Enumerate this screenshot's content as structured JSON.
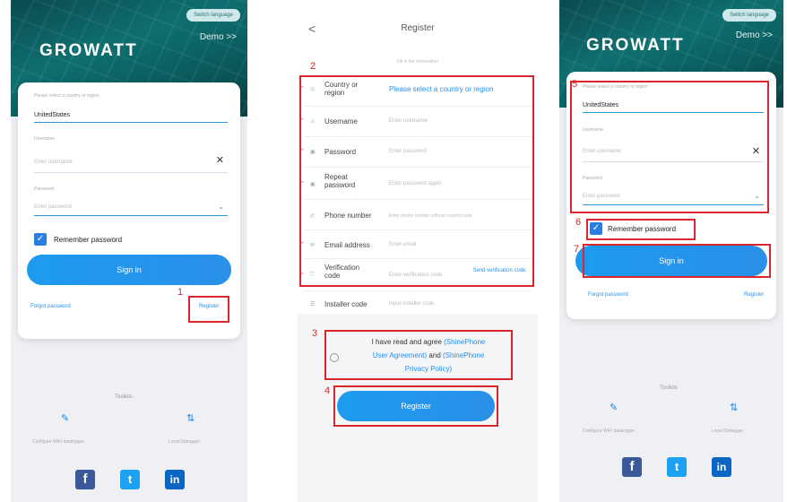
{
  "login1": {
    "lang_pill": "Switch language",
    "demo": "Demo >>",
    "logo": "GROWATT",
    "country_label": "Please select a country or region",
    "country_value": "UnitedStates",
    "user_label": "Username",
    "user_placeholder": "Enter username",
    "pwd_label": "Password",
    "pwd_placeholder": "Enter password",
    "remember": "Remember password",
    "signin": "Sign in",
    "forgot": "Forgot password",
    "register": "Register",
    "tools_title": "Toolkits",
    "tool1": "Configure WiFi datalogger",
    "tool2": "Local Debugger",
    "ann1": "1"
  },
  "register": {
    "back": "<",
    "title": "Register",
    "hint": "Fill in the information",
    "ann2": "2",
    "ann3": "3",
    "ann4": "4",
    "rows": [
      {
        "label": "Country or region",
        "placeholder": "Please select a country or region"
      },
      {
        "label": "Username",
        "placeholder": "Enter username"
      },
      {
        "label": "Password",
        "placeholder": "Enter password"
      },
      {
        "label": "Repeat password",
        "placeholder": "Enter password again"
      },
      {
        "label": "Phone number",
        "placeholder": "Enter phone number without country code"
      },
      {
        "label": "Email address",
        "placeholder": "Enter email"
      },
      {
        "label": "Verification code",
        "placeholder": "Enter verification code",
        "send": "Send verification code"
      },
      {
        "label": "Installer code",
        "placeholder": "Input installer code"
      }
    ],
    "agree_pre": "I have read and agree",
    "agree_l1": "(ShinePhone",
    "agree_l2": "User Agreement)",
    "agree_and": "and",
    "agree_l3": "(ShinePhone",
    "agree_l4": "Privacy Policy)",
    "register_btn": "Register"
  },
  "login2": {
    "lang_pill": "Switch language",
    "demo": "Demo >>",
    "logo": "GROWATT",
    "country_label": "Please select a country or region",
    "country_value": "UnitedStates",
    "user_label": "Username",
    "user_placeholder": "Enter username",
    "pwd_label": "Password",
    "pwd_placeholder": "Enter password",
    "remember": "Remember password",
    "signin": "Sign in",
    "forgot": "Forgot password",
    "register": "Register",
    "tools_title": "Toolkits",
    "tool1": "Configure WiFi datalogger",
    "tool2": "Local Debugger",
    "ann5": "5",
    "ann6": "6",
    "ann7": "7"
  },
  "colors": {
    "accent": "#2a8fe8",
    "annotation": "#d9252e",
    "header": "#0e6f70"
  }
}
